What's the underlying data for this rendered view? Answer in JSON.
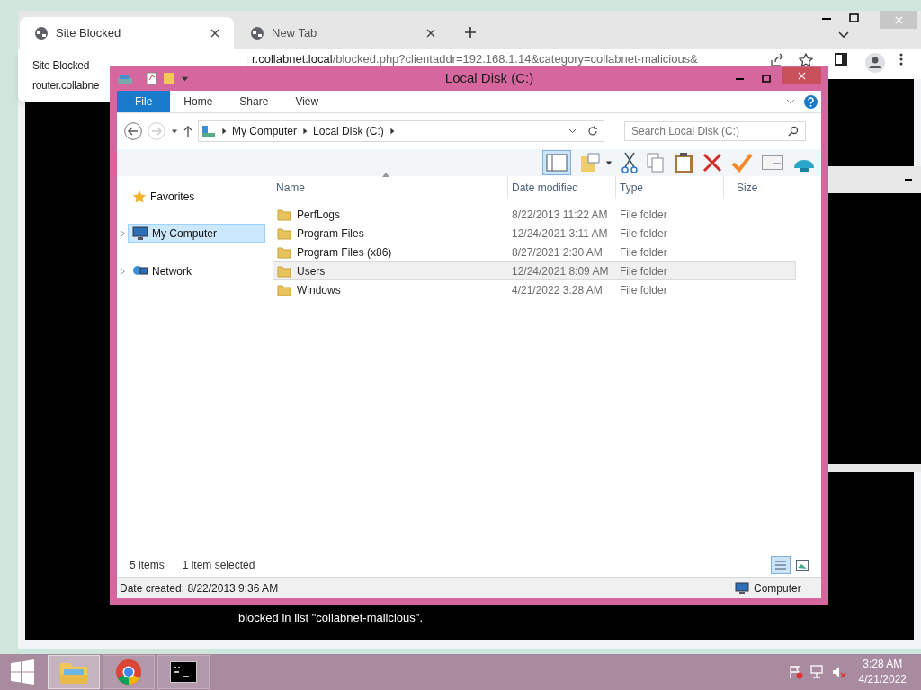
{
  "browser": {
    "tabs": [
      {
        "title": "Site Blocked",
        "selected": true
      },
      {
        "title": "New Tab",
        "selected": false
      }
    ],
    "url_host": "r.collabnet.local",
    "url_path": "/blocked.php?clientaddr=192.168.1.14&category=collabnet-malicious&",
    "hover_card": {
      "title": "Site Blocked",
      "url": "router.collabne"
    },
    "page_text": "blocked in list \"collabnet-malicious\"."
  },
  "explorer": {
    "title": "Local Disk (C:)",
    "ribbon_tabs": [
      {
        "label": "File",
        "selected": true
      },
      {
        "label": "Home",
        "selected": false
      },
      {
        "label": "Share",
        "selected": false
      },
      {
        "label": "View",
        "selected": false
      }
    ],
    "breadcrumb": [
      "My Computer",
      "Local Disk (C:)"
    ],
    "search": {
      "placeholder": "Search Local Disk (C:)"
    },
    "nav": [
      {
        "label": "Favorites",
        "kind": "favorites",
        "selected": false
      },
      {
        "label": "My Computer",
        "kind": "computer",
        "selected": true
      },
      {
        "label": "Network",
        "kind": "network",
        "selected": false
      }
    ],
    "columns": [
      "Name",
      "Date modified",
      "Type",
      "Size"
    ],
    "rows": [
      {
        "name": "PerfLogs",
        "date": "8/22/2013 11:22 AM",
        "type": "File folder",
        "selected": false
      },
      {
        "name": "Program Files",
        "date": "12/24/2021 3:11 AM",
        "type": "File folder",
        "selected": false
      },
      {
        "name": "Program Files (x86)",
        "date": "8/27/2021 2:30 AM",
        "type": "File folder",
        "selected": false
      },
      {
        "name": "Users",
        "date": "12/24/2021 8:09 AM",
        "type": "File folder",
        "selected": true
      },
      {
        "name": "Windows",
        "date": "4/21/2022 3:28 AM",
        "type": "File folder",
        "selected": false
      }
    ],
    "status": {
      "count": "5 items",
      "selection": "1 item selected"
    },
    "details": {
      "text": "Date created: 8/22/2013 9:36 AM",
      "location": "Computer"
    }
  },
  "taskbar": {
    "apps": [
      {
        "kind": "explorer",
        "selected": true
      },
      {
        "kind": "chrome",
        "selected": false
      },
      {
        "kind": "cmd",
        "selected": false
      }
    ],
    "time": "3:28 AM",
    "date": "4/21/2022"
  }
}
